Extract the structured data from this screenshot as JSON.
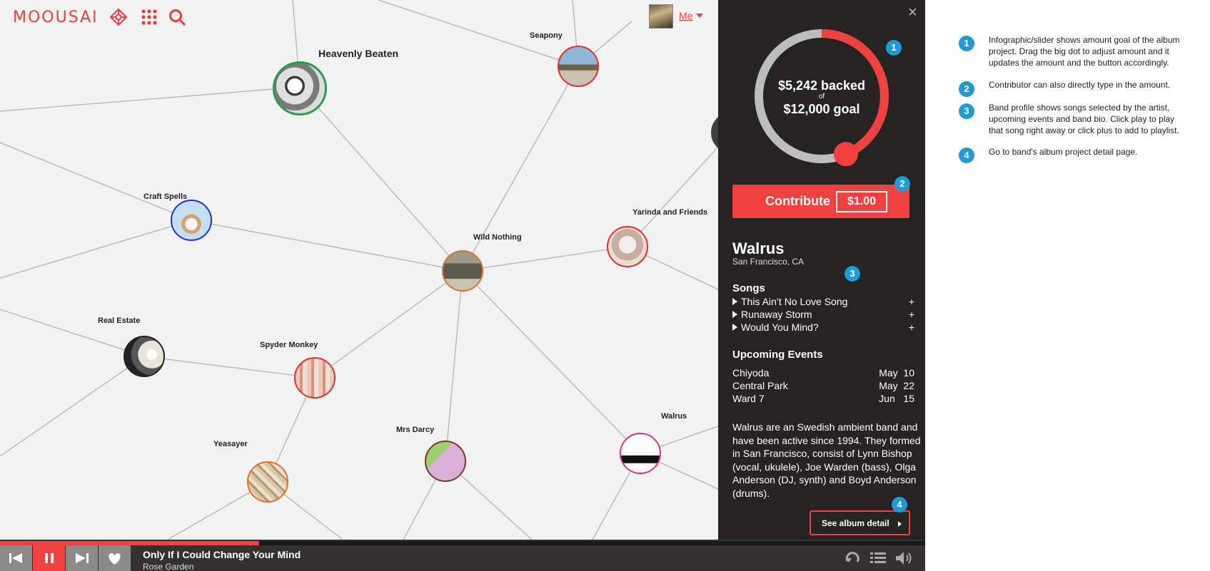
{
  "header": {
    "logo": "MOOUSAI",
    "user_label": "Me"
  },
  "graph": {
    "nodes": [
      {
        "label": "Heavenly Beaten"
      },
      {
        "label": "Seapony"
      },
      {
        "label": "Craft Spells"
      },
      {
        "label": "Wild Nothing"
      },
      {
        "label": "Yarinda and Friends"
      },
      {
        "label": "Real Estate"
      },
      {
        "label": "Spyder Monkey"
      },
      {
        "label": "Mrs Darcy"
      },
      {
        "label": "Yeasayer"
      },
      {
        "label": "Walrus"
      }
    ]
  },
  "panel": {
    "close": "×",
    "funding": {
      "backed": "$5,242 backed",
      "of": "of",
      "goal": "$12,000 goal",
      "progress": 0.437
    },
    "contribute": {
      "label": "Contribute",
      "amount": "$1.00"
    },
    "band": {
      "name": "Walrus",
      "location": "San Francisco, CA"
    },
    "songs_title": "Songs",
    "songs": [
      {
        "title": "This Ain’t No Love Song",
        "add": "+"
      },
      {
        "title": "Runaway Storm",
        "add": "+"
      },
      {
        "title": "Would You Mind?",
        "add": "+"
      }
    ],
    "events_title": "Upcoming Events",
    "events": [
      {
        "venue": "Chiyoda",
        "date": "May  10"
      },
      {
        "venue": "Central Park",
        "date": "May  22"
      },
      {
        "venue": "Ward 7",
        "date": "Jun   15"
      }
    ],
    "bio": "Walrus are an Swedish ambient band and have been active since 1994. They formed in San Francisco, consist of Lynn Bishop (vocal, ukulele), Joe Warden (bass), Olga Anderson (DJ, synth) and Boyd Anderson (drums).",
    "album_button": "See album detail"
  },
  "player": {
    "track_title": "Only If I Could Change Your Mind",
    "track_artist": "Rose Garden",
    "progress": 0.28
  },
  "callouts": [
    "1",
    "2",
    "3",
    "4"
  ],
  "annotations": [
    {
      "num": "1",
      "text": "Infographic/slider shows amount goal of the album project. Drag the big dot to adjust amount and it updates the amount and the button accordingly."
    },
    {
      "num": "2",
      "text": "Contributor can also directly type in the amount."
    },
    {
      "num": "3",
      "text": "Band profile shows songs selected by the artist, upcoming events and band bio. Click play to play that song right away or click plus to add to playlist."
    },
    {
      "num": "4",
      "text": "Go to band's album project detail page."
    }
  ],
  "colors": {
    "accent": "#f04040",
    "panel_bg": "#262323",
    "callout": "#1e9ad6",
    "graph_bg": "#f2f2f2"
  }
}
